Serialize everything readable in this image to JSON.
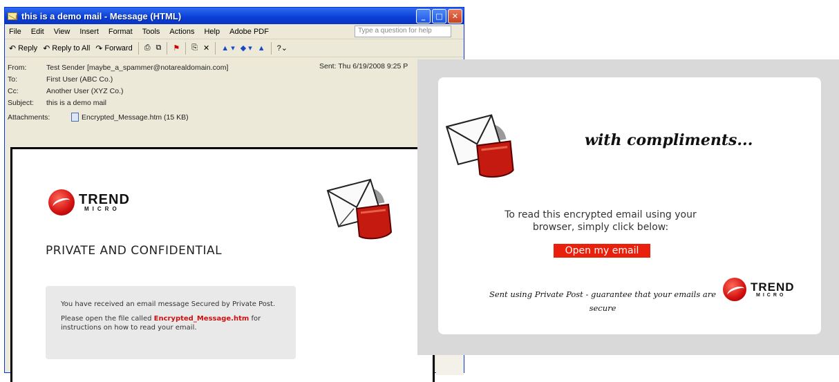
{
  "window": {
    "title": "this is a demo mail - Message (HTML)",
    "menu": [
      "File",
      "Edit",
      "View",
      "Insert",
      "Format",
      "Tools",
      "Actions",
      "Help",
      "Adobe PDF"
    ],
    "help_placeholder": "Type a question for help",
    "toolbar": {
      "reply": "Reply",
      "reply_all": "Reply to All",
      "forward": "Forward"
    }
  },
  "headers": {
    "from_label": "From:",
    "from": "Test Sender [maybe_a_spammer@notarealdomain.com]",
    "to_label": "To:",
    "to": "First User (ABC Co.)",
    "cc_label": "Cc:",
    "cc": "Another User (XYZ Co.)",
    "subject_label": "Subject:",
    "subject": "this is a demo mail",
    "sent_label": "Sent:",
    "sent": "Thu 6/19/2008 9:25 P",
    "attachments_label": "Attachments:",
    "attachment": "Encrypted_Message.htm (15 KB)"
  },
  "message": {
    "brand_line1": "TREND",
    "brand_line2": "MICRO",
    "heading": "PRIVATE AND CONFIDENTIAL",
    "notice_line1": "You have received an email message Secured by Private Post.",
    "notice_line2_pre": "Please open the file called ",
    "notice_filename": "Encrypted_Message.htm",
    "notice_line2_post": " for instructions on how to read your email."
  },
  "overlay": {
    "heading": "with compliments...",
    "read_text": "To read this encrypted email using your browser, simply click below:",
    "open_button": "Open my email",
    "footer": "Sent using Private Post - guarantee that your emails are secure",
    "brand_line1": "TREND",
    "brand_line2": "MICRO"
  },
  "colors": {
    "titlebar": "#0a3ed6",
    "accent_red": "#e8200c",
    "filename_red": "#d01010"
  }
}
